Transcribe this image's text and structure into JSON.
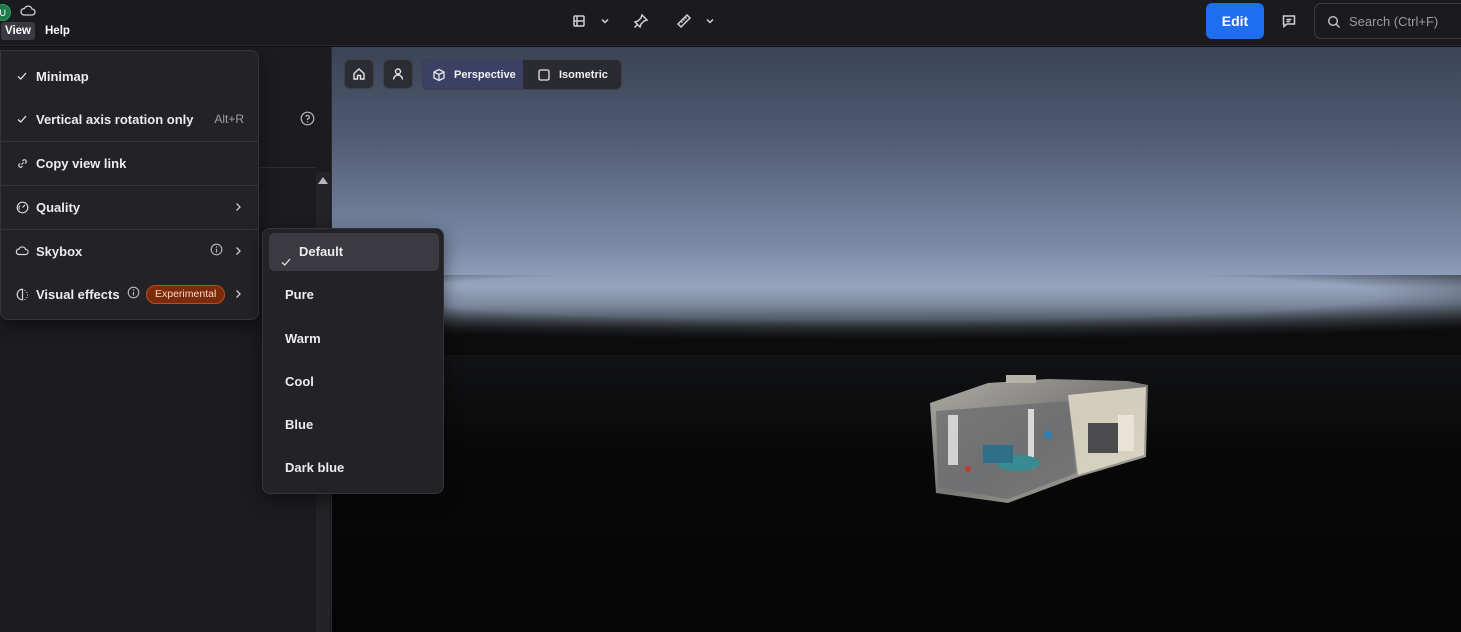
{
  "topbar": {
    "avatar_initial": "U",
    "menus": {
      "view": "View",
      "help": "Help"
    },
    "edit_button": "Edit",
    "search_placeholder": "Search (Ctrl+F)",
    "icons": [
      "cloud-icon",
      "layers-icon",
      "chevron-down-icon",
      "pin-icon",
      "measure-icon",
      "chevron-down-icon",
      "comment-icon",
      "search-icon"
    ]
  },
  "view_menu": {
    "items": [
      {
        "label": "Minimap",
        "checked": true,
        "icon": "check-icon"
      },
      {
        "label": "Vertical axis rotation only",
        "checked": true,
        "shortcut": "Alt+R",
        "icon": "check-icon"
      },
      {
        "label": "Copy view link",
        "icon": "link-icon"
      },
      {
        "label": "Quality",
        "icon": "gauge-icon",
        "has_submenu": true
      },
      {
        "label": "Skybox",
        "icon": "cloud-icon",
        "has_submenu": true,
        "info": true
      },
      {
        "label": "Visual effects",
        "icon": "contrast-icon",
        "has_submenu": true,
        "info": true,
        "badge": "Experimental"
      }
    ]
  },
  "skybox_menu": {
    "selected": "Default",
    "options": [
      "Default",
      "Pure",
      "Warm",
      "Cool",
      "Blue",
      "Dark blue"
    ]
  },
  "viewport": {
    "projection": {
      "active": "Perspective",
      "options": [
        "Perspective",
        "Isometric"
      ]
    },
    "buttons": [
      "home-icon",
      "user-icon"
    ]
  },
  "colors": {
    "accent": "#1e6ef0",
    "badge": "#7a2b0c",
    "active_projection": "#3c4064"
  }
}
